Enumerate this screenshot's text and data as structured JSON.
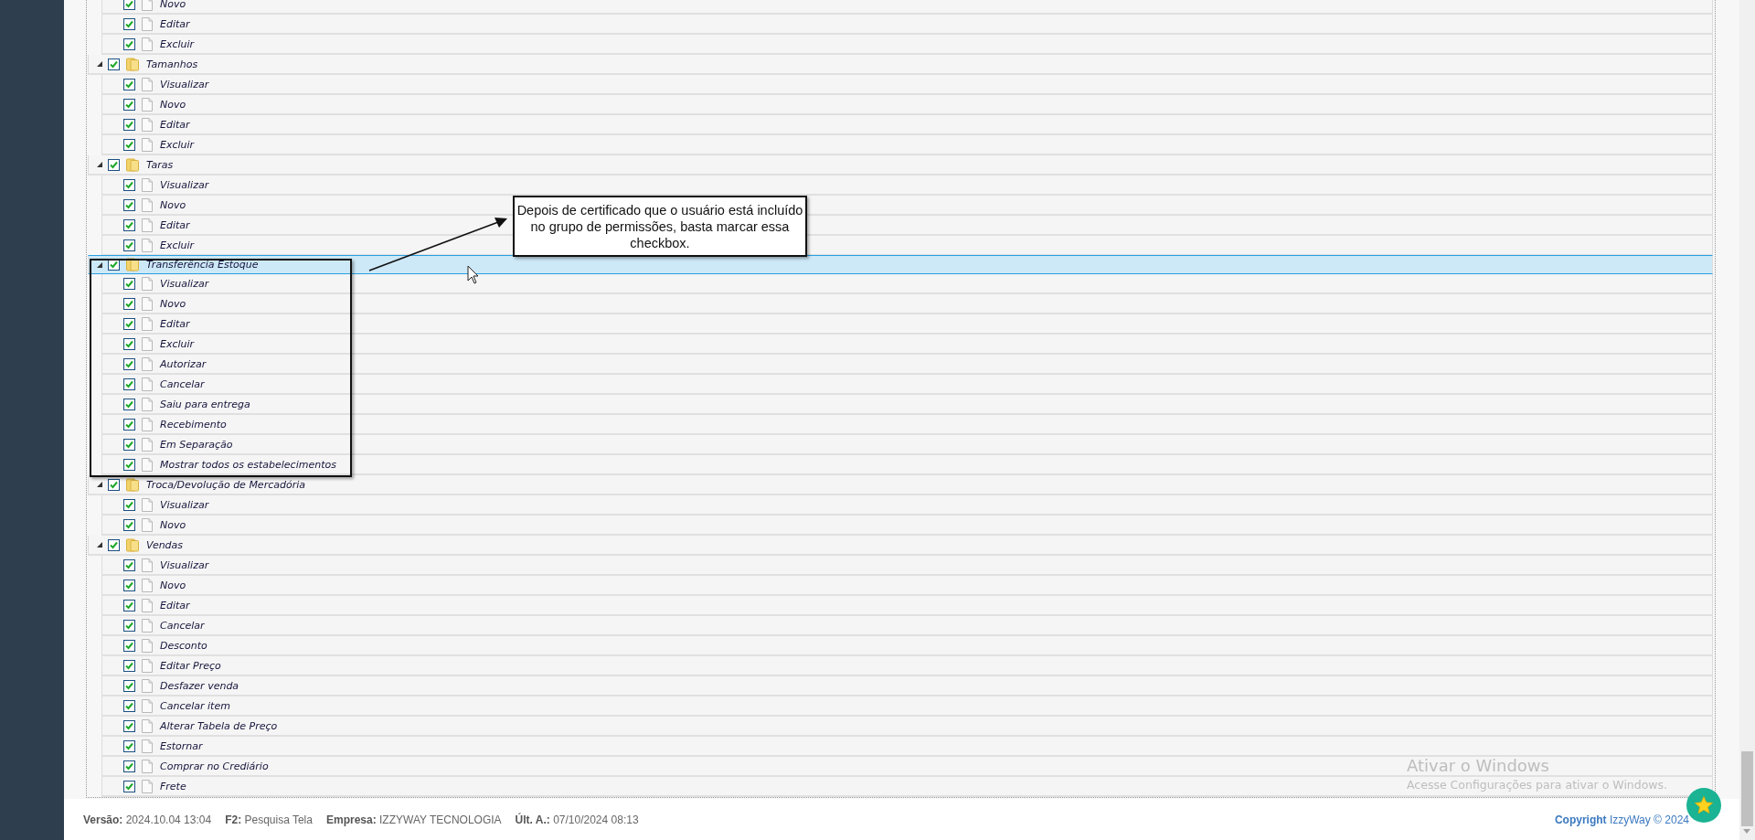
{
  "tree": {
    "continued_children": [
      {
        "label": "Novo",
        "checked": true
      },
      {
        "label": "Editar",
        "checked": true
      },
      {
        "label": "Excluir",
        "checked": true
      }
    ],
    "nodes": [
      {
        "label": "Tamanhos",
        "checked": true,
        "expanded": true,
        "selected": false,
        "children": [
          {
            "label": "Visualizar",
            "checked": true
          },
          {
            "label": "Novo",
            "checked": true
          },
          {
            "label": "Editar",
            "checked": true
          },
          {
            "label": "Excluir",
            "checked": true
          }
        ]
      },
      {
        "label": "Taras",
        "checked": true,
        "expanded": true,
        "selected": false,
        "children": [
          {
            "label": "Visualizar",
            "checked": true
          },
          {
            "label": "Novo",
            "checked": true
          },
          {
            "label": "Editar",
            "checked": true
          },
          {
            "label": "Excluir",
            "checked": true
          }
        ]
      },
      {
        "label": "Transferência Estoque",
        "checked": true,
        "expanded": true,
        "selected": true,
        "children": [
          {
            "label": "Visualizar",
            "checked": true
          },
          {
            "label": "Novo",
            "checked": true
          },
          {
            "label": "Editar",
            "checked": true
          },
          {
            "label": "Excluir",
            "checked": true
          },
          {
            "label": "Autorizar",
            "checked": true
          },
          {
            "label": "Cancelar",
            "checked": true
          },
          {
            "label": "Saiu para entrega",
            "checked": true
          },
          {
            "label": "Recebimento",
            "checked": true
          },
          {
            "label": "Em Separação",
            "checked": true
          },
          {
            "label": "Mostrar todos os estabelecimentos",
            "checked": true
          }
        ]
      },
      {
        "label": "Troca/Devolução de Mercadória",
        "checked": true,
        "expanded": true,
        "selected": false,
        "children": [
          {
            "label": "Visualizar",
            "checked": true
          },
          {
            "label": "Novo",
            "checked": true
          }
        ]
      },
      {
        "label": "Vendas",
        "checked": true,
        "expanded": true,
        "selected": false,
        "children": [
          {
            "label": "Visualizar",
            "checked": true
          },
          {
            "label": "Novo",
            "checked": true
          },
          {
            "label": "Editar",
            "checked": true
          },
          {
            "label": "Cancelar",
            "checked": true
          },
          {
            "label": "Desconto",
            "checked": true
          },
          {
            "label": "Editar Preço",
            "checked": true
          },
          {
            "label": "Desfazer venda",
            "checked": true
          },
          {
            "label": "Cancelar item",
            "checked": true
          },
          {
            "label": "Alterar Tabela de Preço",
            "checked": true
          },
          {
            "label": "Estornar",
            "checked": true
          },
          {
            "label": "Comprar no Crediário",
            "checked": true
          },
          {
            "label": "Frete",
            "checked": true
          }
        ]
      }
    ]
  },
  "annotation": {
    "text": "Depois de certificado que o usuário está incluído no grupo de permissões, basta marcar essa checkbox."
  },
  "os_notice": {
    "title": "Ativar o Windows",
    "text": "Acesse Configurações para ativar o Windows."
  },
  "footer": {
    "items": [
      "**Versão:** 2024.10.04 13:04",
      "**F2:** Pesquisa Tela",
      "**Empresa:** IZZYWAY TECNOLOGIA",
      "**Últ. A.:** 07/10/2024 08:13"
    ],
    "copyright": "**Copyright** IzzyWay © 2024"
  }
}
